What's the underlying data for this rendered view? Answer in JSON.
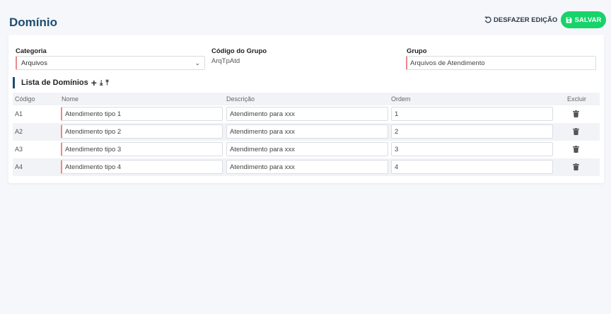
{
  "header": {
    "title": "Domínio",
    "undo_label": "DESFAZER EDIÇÃO",
    "save_label": "SALVAR",
    "save_color": "#17d36a"
  },
  "form": {
    "categoria_label": "Categoria",
    "categoria_value": "Arquivos",
    "codigo_grupo_label": "Código do Grupo",
    "codigo_grupo_value": "ArqTpAtd",
    "grupo_label": "Grupo",
    "grupo_value": "Arquivos de Atendimento"
  },
  "list": {
    "title": "Lista de Domínios",
    "columns": {
      "codigo": "Código",
      "nome": "Nome",
      "descricao": "Descrição",
      "ordem": "Ordem",
      "excluir": "Excluir"
    },
    "rows": [
      {
        "codigo": "A1",
        "nome": "Atendimento tipo 1",
        "descricao": "Atendimento para xxx",
        "ordem": "1"
      },
      {
        "codigo": "A2",
        "nome": "Atendimento tipo 2",
        "descricao": "Atendimento para xxx",
        "ordem": "2"
      },
      {
        "codigo": "A3",
        "nome": "Atendimento tipo 3",
        "descricao": "Atendimento para xxx",
        "ordem": "3"
      },
      {
        "codigo": "A4",
        "nome": "Atendimento tipo 4",
        "descricao": "Atendimento para xxx",
        "ordem": "4"
      }
    ]
  },
  "icons": {
    "undo": "undo-icon",
    "save": "floppy-icon",
    "add": "plus-icon",
    "download": "download-icon",
    "upload": "upload-icon",
    "delete": "trash-icon",
    "dropdown": "chevron-down-icon"
  }
}
